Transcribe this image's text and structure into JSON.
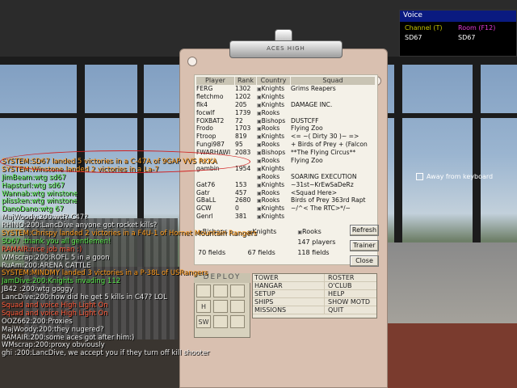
{
  "voice": {
    "title": "Voice",
    "channel_label": "Channel (T)",
    "room_label": "Room (F12)",
    "channel_user": "SD67",
    "room_user": "SD67",
    "colors": {
      "channel": "#c7c700",
      "room": "#e23ad6",
      "title_bg": "#0a1a80"
    }
  },
  "clipboard_label": "ACES HIGH",
  "roster": {
    "headers": [
      "Player",
      "Rank",
      "Country",
      "Squad"
    ],
    "rows": [
      {
        "player": "FERG",
        "rank": "1302",
        "country": "Knights",
        "squad": "Grims Reapers"
      },
      {
        "player": "fletchmo",
        "rank": "1202",
        "country": "Knights",
        "squad": ""
      },
      {
        "player": "flk4",
        "rank": "205",
        "country": "Knights",
        "squad": "DAMAGE INC."
      },
      {
        "player": "focwlf",
        "rank": "1739",
        "country": "Rooks",
        "squad": ""
      },
      {
        "player": "FOXBAT2",
        "rank": "72",
        "country": "Bishops",
        "squad": "DUSTCFF"
      },
      {
        "player": "Frodo",
        "rank": "1703",
        "country": "Rooks",
        "squad": "Flying Zoo"
      },
      {
        "player": "Ftroop",
        "rank": "819",
        "country": "Knights",
        "squad": "<= ~( Dirty 30 )~ =>"
      },
      {
        "player": "Fungi987",
        "rank": "95",
        "country": "Rooks",
        "squad": "+ Birds of Prey + (Falcon"
      },
      {
        "player": "FWARHAWI",
        "rank": "2083",
        "country": "Bishops",
        "squad": "**The Flying Circus**"
      },
      {
        "player": "",
        "rank": "",
        "country": "Rooks",
        "squad": "Flying Zoo"
      },
      {
        "player": "gambin",
        "rank": "1954",
        "country": "Knights",
        "squad": ""
      },
      {
        "player": "",
        "rank": "",
        "country": "Rooks",
        "squad": "SOARING EXECUTION"
      },
      {
        "player": "Gat76",
        "rank": "153",
        "country": "Knights",
        "squad": "~31st~KrEwSaDeRz"
      },
      {
        "player": "Gatr",
        "rank": "457",
        "country": "Rooks",
        "squad": "<Squad Here>"
      },
      {
        "player": "GBaLL",
        "rank": "2680",
        "country": "Rooks",
        "squad": "Birds of Prey 363rd Rapt"
      },
      {
        "player": "GCW",
        "rank": "0",
        "country": "Knights",
        "squad": "~/^< The RTC>*/~"
      },
      {
        "player": "Genrl",
        "rank": "381",
        "country": "Knights",
        "squad": ""
      }
    ]
  },
  "counts": {
    "countries": [
      "Bishops",
      "Knights",
      "Rooks"
    ],
    "players": [
      "",
      "",
      "147 players"
    ],
    "fields": [
      "70 fields",
      "67 fields",
      "118 fields"
    ]
  },
  "buttons": {
    "refresh": "Refresh",
    "trainer": "Trainer",
    "close": "Close"
  },
  "deploy": {
    "title": "DEPLOY",
    "cells": [
      "",
      "",
      "",
      "H",
      "",
      "",
      "SW",
      "",
      ""
    ]
  },
  "menu": [
    [
      "TOWER",
      "ROSTER"
    ],
    [
      "HANGAR",
      "O'CLUB"
    ],
    [
      "SETUP",
      "HELP"
    ],
    [
      "SHIPS",
      "SHOW MOTD"
    ],
    [
      "MISSIONS",
      "QUIT"
    ]
  ],
  "away_label": "Away from keyboard",
  "chat": [
    {
      "text": "SYSTEM:SD67 landed 5 victories in a C-47A of 9GAP VVS RKKA",
      "color": "#ff9a1a"
    },
    {
      "text": "SYSTEM:Winstone landed 2 victories in a La-7",
      "color": "#ff9a1a"
    },
    {
      "text": "JimBeam:wtg sd67",
      "color": "#56e84a"
    },
    {
      "text": "Hapsturl:wtg sd67",
      "color": "#56e84a"
    },
    {
      "text": "Wannab:wtg winstone",
      "color": "#56e84a"
    },
    {
      "text": "plissken:wtg winstone",
      "color": "#56e84a"
    },
    {
      "text": "DanoDano:wtg 67",
      "color": "#56e84a"
    },
    {
      "text": "MajWoody:200:wtf? C47?",
      "color": "#e8e8e8"
    },
    {
      "text": "RHINO:200:LancDive anyone got rocket kills?",
      "color": "#e8e8e8"
    },
    {
      "text": "SYSTEM:Chrispy landed 2 victories in a F4U-1 of Hornet Mountain Rangers",
      "color": "#ff9a1a"
    },
    {
      "text": "SD67 :thank you all gentlemen!",
      "color": "#56e84a"
    },
    {
      "text": "RAMAIR:nice job man :)",
      "color": "#ff5a3a"
    },
    {
      "text": "WMscrap:200:ROFL 5 in a goon",
      "color": "#e8e8e8"
    },
    {
      "text": "RuAm:200:ARENA CATTLE",
      "color": "#e8e8e8"
    },
    {
      "text": "SYSTEM:MINDMY landed 3 victories in a P-38L of USRangers",
      "color": "#ff9a1a"
    },
    {
      "text": "JamDive:200:Knights invading 112",
      "color": "#56e84a"
    },
    {
      "text": "JB42 :200:wtg goggy",
      "color": "#e8e8e8"
    },
    {
      "text": "LancDive:200:how did he get 5 kills in C47? LOL",
      "color": "#e8e8e8"
    },
    {
      "text": "Squad and voice High Light On",
      "color": "#ff5a3a"
    },
    {
      "text": "Squad and voice High Light On",
      "color": "#ff5a3a"
    },
    {
      "text": "OOZ662:200:Proxies",
      "color": "#e8e8e8"
    },
    {
      "text": "MajWoody:200:they nugered?",
      "color": "#e8e8e8"
    },
    {
      "text": "RAMAIR:200:some aces got after him:)",
      "color": "#e8e8e8"
    },
    {
      "text": "WMscrap:200:proxy obviously",
      "color": "#e8e8e8"
    },
    {
      "text": "ghi :200:LancDive, we accept you if they turn off kill shooter",
      "color": "#e8e8e8"
    }
  ]
}
